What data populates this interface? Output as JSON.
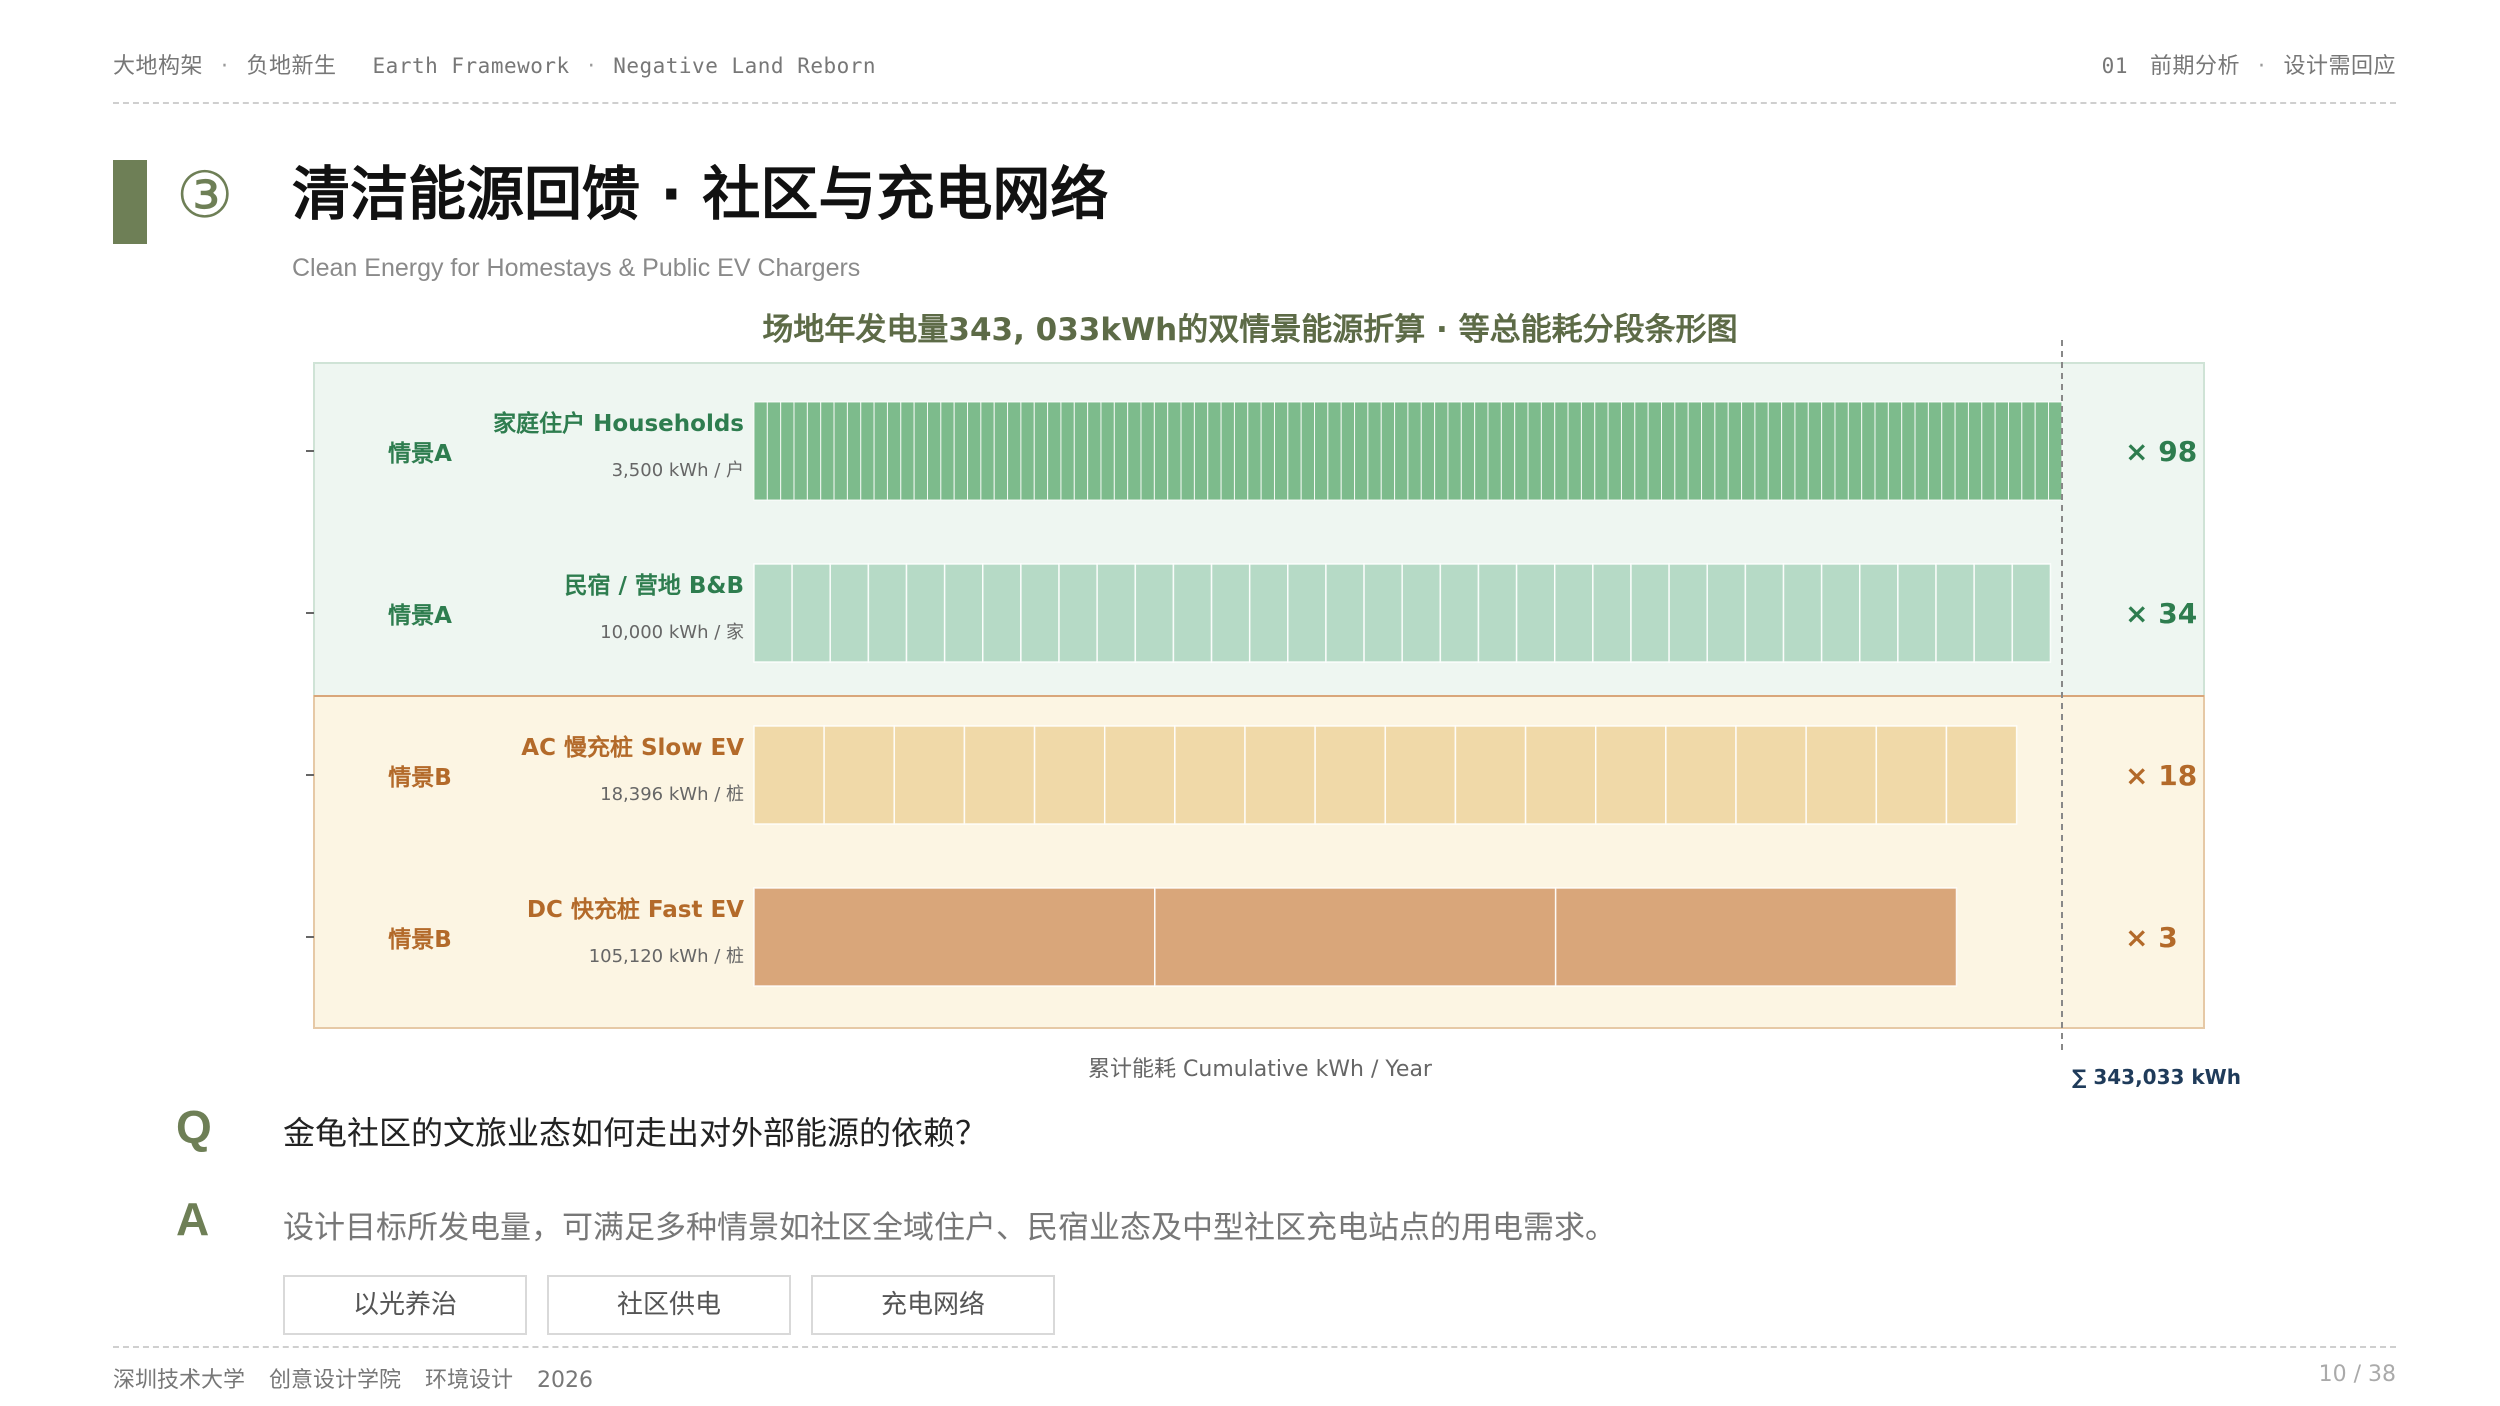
{
  "header": {
    "left": [
      "大地构架",
      "负地新生",
      "Earth Framework",
      "Negative Land Reborn"
    ],
    "right": [
      "01",
      "前期分析",
      "设计需回应"
    ]
  },
  "title": {
    "number": "③",
    "main": "清洁能源回馈 · 社区与充电网络",
    "subtitle": "Clean Energy for Homestays & Public EV Chargers"
  },
  "chart_data": {
    "type": "bar",
    "title": "场地年发电量343, 033kWh的双情景能源折算 · 等总能耗分段条形图",
    "xlabel": "累计能耗  Cumulative kWh / Year",
    "total_label": "∑ 343,033 kWh",
    "total": 343033,
    "xlim": [
      0,
      343033
    ],
    "colors": {
      "scenario_a_bg": "#eef6f1",
      "scenario_b_bg": "#fcf5e3",
      "scenario_a_text": "#2e7d4f",
      "scenario_b_text": "#b36a2a"
    },
    "rows": [
      {
        "scenario": "情景A",
        "group": "A",
        "name": "家庭住户  Households",
        "unit_label": "3,500 kWh / 户",
        "unit_kwh": 3500,
        "count": 98,
        "count_label": "×  98",
        "color": "#7dbb8c"
      },
      {
        "scenario": "情景A",
        "group": "A",
        "name": "民宿 / 营地  B&B",
        "unit_label": "10,000 kWh / 家",
        "unit_kwh": 10000,
        "count": 34,
        "count_label": "×  34",
        "color": "#b6dac6"
      },
      {
        "scenario": "情景B",
        "group": "B",
        "name": "AC 慢充桩  Slow EV",
        "unit_label": "18,396 kWh / 桩",
        "unit_kwh": 18396,
        "count": 18,
        "count_label": "×  18",
        "color": "#f0d9a8"
      },
      {
        "scenario": "情景B",
        "group": "B",
        "name": "DC 快充桩  Fast EV",
        "unit_label": "105,120 kWh / 桩",
        "unit_kwh": 105120,
        "count": 3,
        "count_label": "×  3",
        "color": "#d9a67a"
      }
    ]
  },
  "qa": {
    "q_letter": "Q",
    "question": "金龟社区的文旅业态如何走出对外部能源的依赖？",
    "a_letter": "A",
    "answer": "设计目标所发电量，可满足多种情景如社区全域住户、民宿业态及中型社区充电站点的用电需求。"
  },
  "tags": [
    "以光养治",
    "社区供电",
    "充电网络"
  ],
  "footer": {
    "items": [
      "深圳技术大学",
      "创意设计学院",
      "环境设计",
      "2026"
    ],
    "page": "10 / 38"
  }
}
